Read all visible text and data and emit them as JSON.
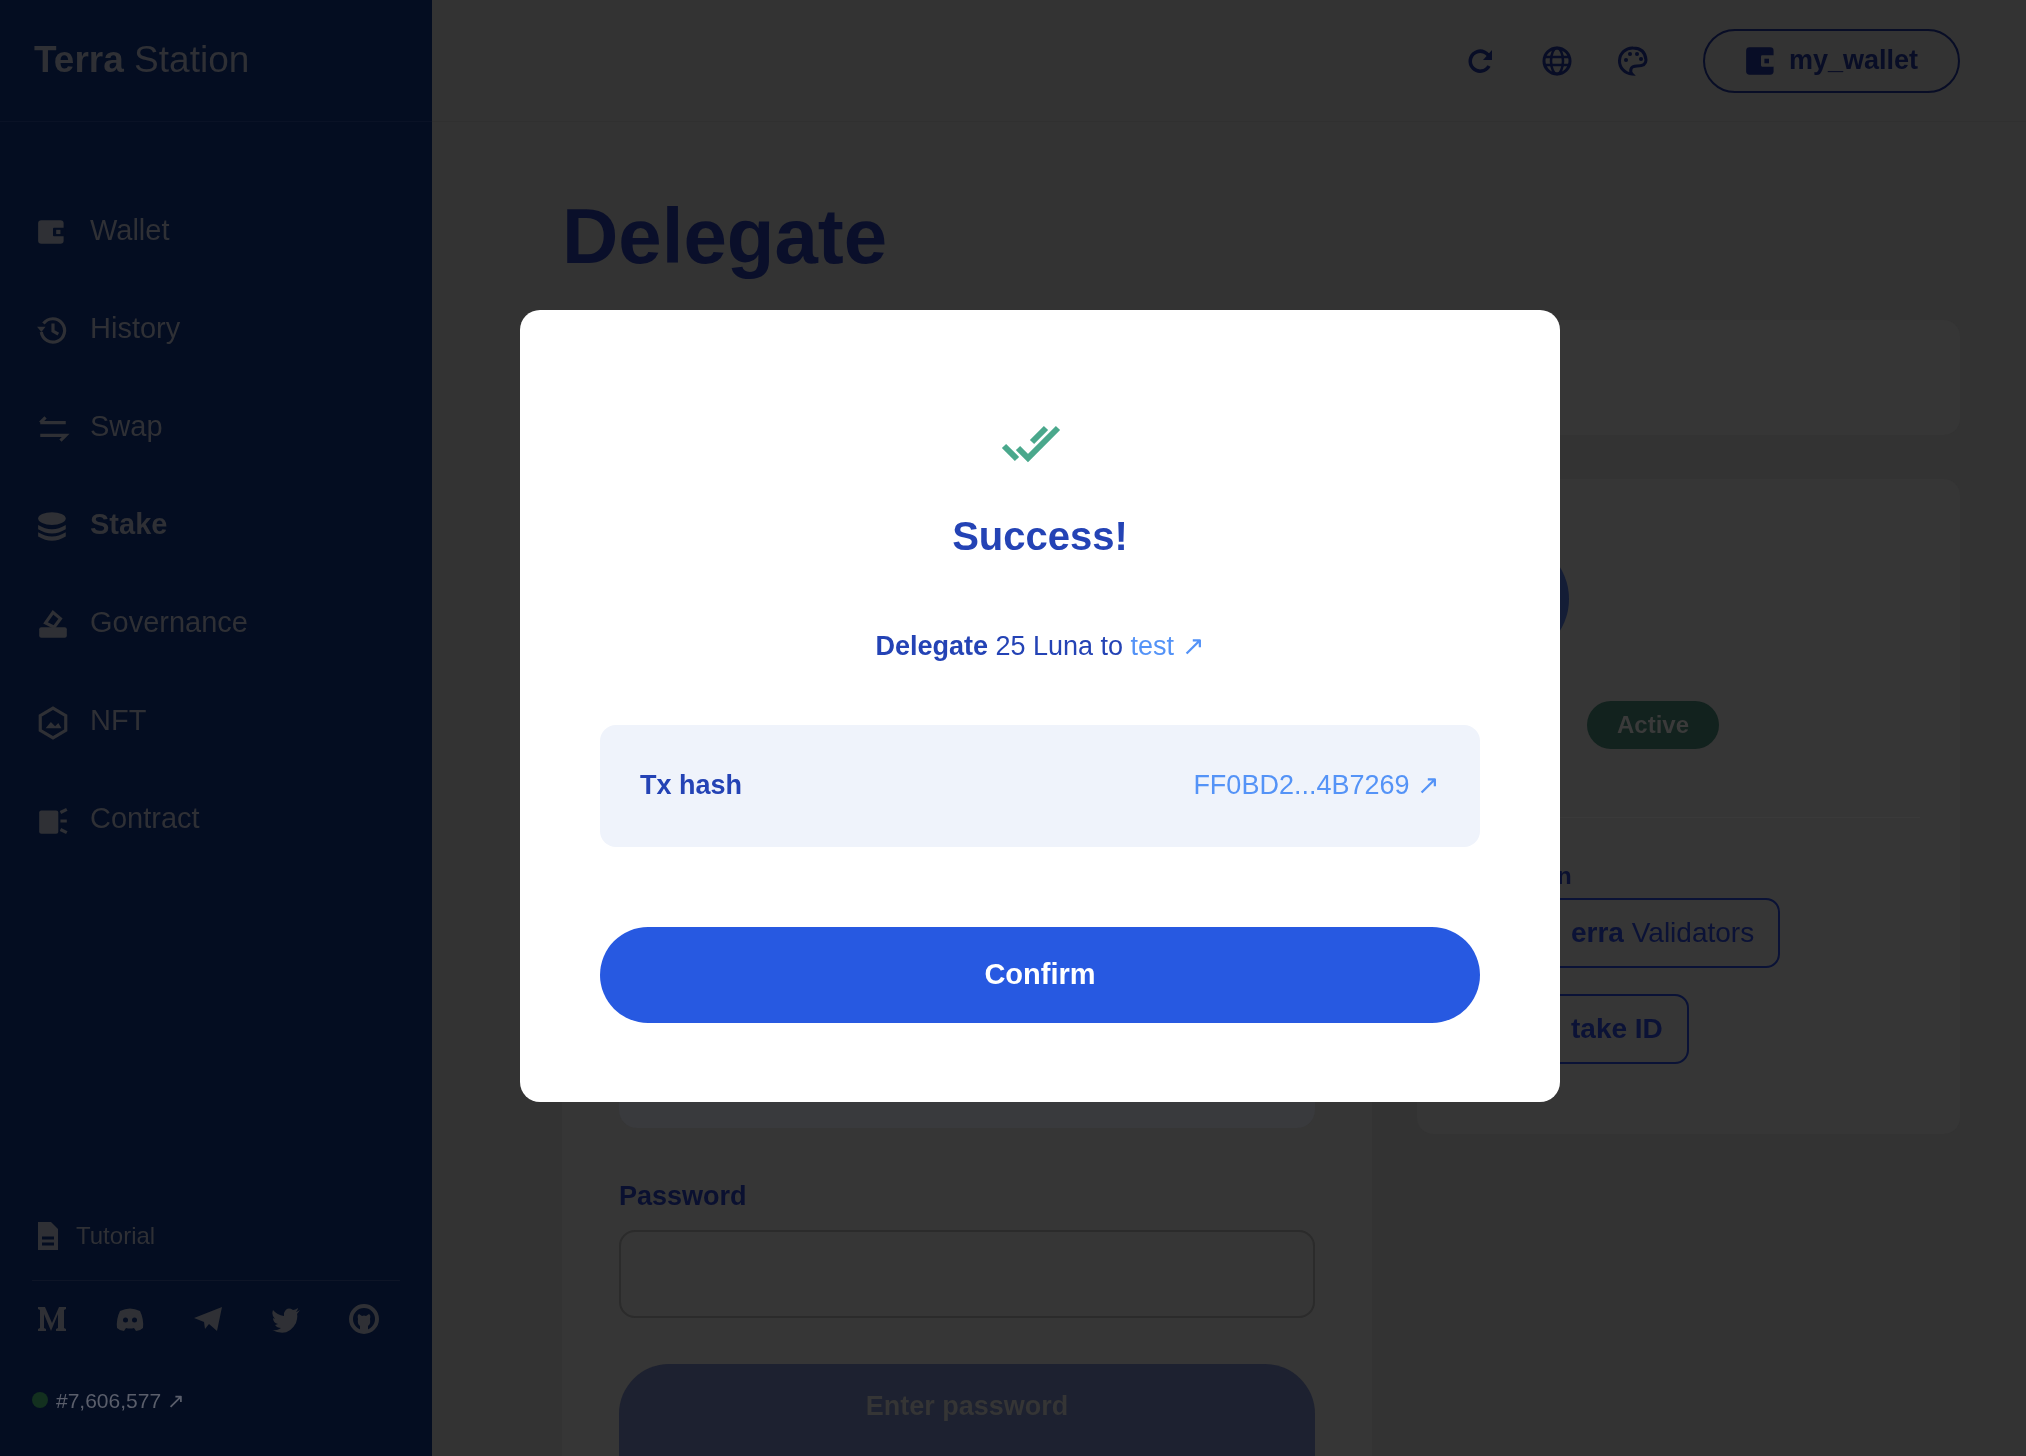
{
  "sidebar": {
    "logo": {
      "bold": "Terra",
      "light": "Station"
    },
    "items": [
      {
        "label": "Wallet",
        "selected": false
      },
      {
        "label": "History",
        "selected": false
      },
      {
        "label": "Swap",
        "selected": false
      },
      {
        "label": "Stake",
        "selected": true
      },
      {
        "label": "Governance",
        "selected": false
      },
      {
        "label": "NFT",
        "selected": false
      },
      {
        "label": "Contract",
        "selected": false
      }
    ],
    "tutorial": "Tutorial",
    "block": "#7,606,577 ↗"
  },
  "header": {
    "wallet": "my_wallet"
  },
  "page": {
    "title": "Delegate",
    "password_label": "Password",
    "submit": "Enter password",
    "validator": {
      "status": "Active",
      "label": "n",
      "buttons": [
        "**erra** Validators",
        "take ID"
      ]
    }
  },
  "modal": {
    "title": "Success!",
    "message": "**Delegate** 25 Luna to",
    "link": "test ↗",
    "tx": {
      "label": "Tx hash",
      "value": "FF0BD2...4B7269 ↗"
    },
    "button": "Confirm"
  }
}
